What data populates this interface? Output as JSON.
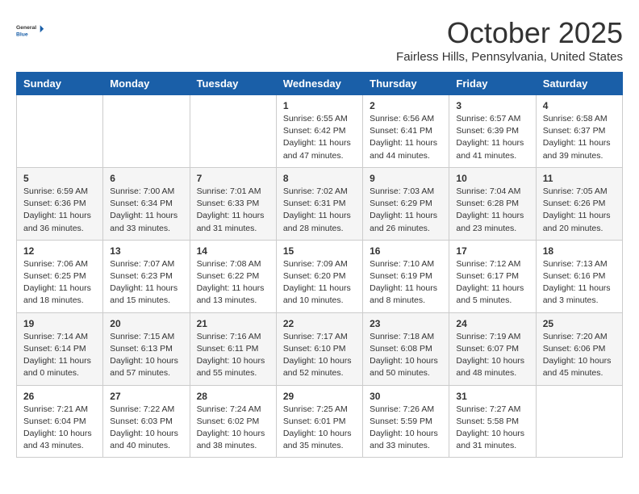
{
  "header": {
    "logo_line1": "General",
    "logo_line2": "Blue",
    "month": "October 2025",
    "location": "Fairless Hills, Pennsylvania, United States"
  },
  "days_of_week": [
    "Sunday",
    "Monday",
    "Tuesday",
    "Wednesday",
    "Thursday",
    "Friday",
    "Saturday"
  ],
  "weeks": [
    [
      {
        "day": "",
        "info": ""
      },
      {
        "day": "",
        "info": ""
      },
      {
        "day": "",
        "info": ""
      },
      {
        "day": "1",
        "info": "Sunrise: 6:55 AM\nSunset: 6:42 PM\nDaylight: 11 hours\nand 47 minutes."
      },
      {
        "day": "2",
        "info": "Sunrise: 6:56 AM\nSunset: 6:41 PM\nDaylight: 11 hours\nand 44 minutes."
      },
      {
        "day": "3",
        "info": "Sunrise: 6:57 AM\nSunset: 6:39 PM\nDaylight: 11 hours\nand 41 minutes."
      },
      {
        "day": "4",
        "info": "Sunrise: 6:58 AM\nSunset: 6:37 PM\nDaylight: 11 hours\nand 39 minutes."
      }
    ],
    [
      {
        "day": "5",
        "info": "Sunrise: 6:59 AM\nSunset: 6:36 PM\nDaylight: 11 hours\nand 36 minutes."
      },
      {
        "day": "6",
        "info": "Sunrise: 7:00 AM\nSunset: 6:34 PM\nDaylight: 11 hours\nand 33 minutes."
      },
      {
        "day": "7",
        "info": "Sunrise: 7:01 AM\nSunset: 6:33 PM\nDaylight: 11 hours\nand 31 minutes."
      },
      {
        "day": "8",
        "info": "Sunrise: 7:02 AM\nSunset: 6:31 PM\nDaylight: 11 hours\nand 28 minutes."
      },
      {
        "day": "9",
        "info": "Sunrise: 7:03 AM\nSunset: 6:29 PM\nDaylight: 11 hours\nand 26 minutes."
      },
      {
        "day": "10",
        "info": "Sunrise: 7:04 AM\nSunset: 6:28 PM\nDaylight: 11 hours\nand 23 minutes."
      },
      {
        "day": "11",
        "info": "Sunrise: 7:05 AM\nSunset: 6:26 PM\nDaylight: 11 hours\nand 20 minutes."
      }
    ],
    [
      {
        "day": "12",
        "info": "Sunrise: 7:06 AM\nSunset: 6:25 PM\nDaylight: 11 hours\nand 18 minutes."
      },
      {
        "day": "13",
        "info": "Sunrise: 7:07 AM\nSunset: 6:23 PM\nDaylight: 11 hours\nand 15 minutes."
      },
      {
        "day": "14",
        "info": "Sunrise: 7:08 AM\nSunset: 6:22 PM\nDaylight: 11 hours\nand 13 minutes."
      },
      {
        "day": "15",
        "info": "Sunrise: 7:09 AM\nSunset: 6:20 PM\nDaylight: 11 hours\nand 10 minutes."
      },
      {
        "day": "16",
        "info": "Sunrise: 7:10 AM\nSunset: 6:19 PM\nDaylight: 11 hours\nand 8 minutes."
      },
      {
        "day": "17",
        "info": "Sunrise: 7:12 AM\nSunset: 6:17 PM\nDaylight: 11 hours\nand 5 minutes."
      },
      {
        "day": "18",
        "info": "Sunrise: 7:13 AM\nSunset: 6:16 PM\nDaylight: 11 hours\nand 3 minutes."
      }
    ],
    [
      {
        "day": "19",
        "info": "Sunrise: 7:14 AM\nSunset: 6:14 PM\nDaylight: 11 hours\nand 0 minutes."
      },
      {
        "day": "20",
        "info": "Sunrise: 7:15 AM\nSunset: 6:13 PM\nDaylight: 10 hours\nand 57 minutes."
      },
      {
        "day": "21",
        "info": "Sunrise: 7:16 AM\nSunset: 6:11 PM\nDaylight: 10 hours\nand 55 minutes."
      },
      {
        "day": "22",
        "info": "Sunrise: 7:17 AM\nSunset: 6:10 PM\nDaylight: 10 hours\nand 52 minutes."
      },
      {
        "day": "23",
        "info": "Sunrise: 7:18 AM\nSunset: 6:08 PM\nDaylight: 10 hours\nand 50 minutes."
      },
      {
        "day": "24",
        "info": "Sunrise: 7:19 AM\nSunset: 6:07 PM\nDaylight: 10 hours\nand 48 minutes."
      },
      {
        "day": "25",
        "info": "Sunrise: 7:20 AM\nSunset: 6:06 PM\nDaylight: 10 hours\nand 45 minutes."
      }
    ],
    [
      {
        "day": "26",
        "info": "Sunrise: 7:21 AM\nSunset: 6:04 PM\nDaylight: 10 hours\nand 43 minutes."
      },
      {
        "day": "27",
        "info": "Sunrise: 7:22 AM\nSunset: 6:03 PM\nDaylight: 10 hours\nand 40 minutes."
      },
      {
        "day": "28",
        "info": "Sunrise: 7:24 AM\nSunset: 6:02 PM\nDaylight: 10 hours\nand 38 minutes."
      },
      {
        "day": "29",
        "info": "Sunrise: 7:25 AM\nSunset: 6:01 PM\nDaylight: 10 hours\nand 35 minutes."
      },
      {
        "day": "30",
        "info": "Sunrise: 7:26 AM\nSunset: 5:59 PM\nDaylight: 10 hours\nand 33 minutes."
      },
      {
        "day": "31",
        "info": "Sunrise: 7:27 AM\nSunset: 5:58 PM\nDaylight: 10 hours\nand 31 minutes."
      },
      {
        "day": "",
        "info": ""
      }
    ]
  ]
}
